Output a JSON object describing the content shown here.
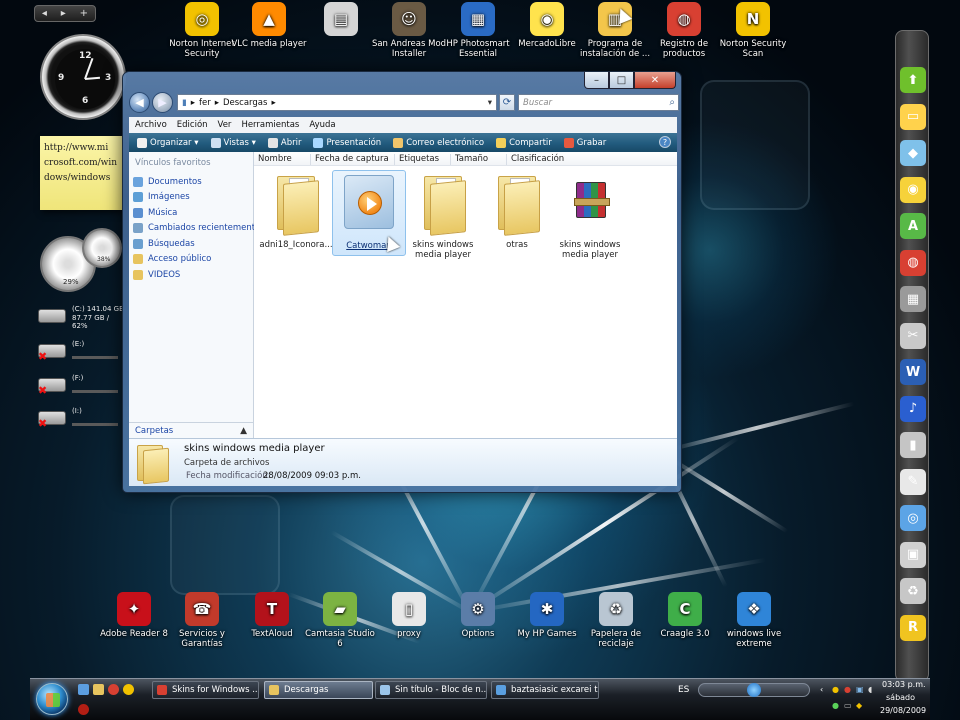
{
  "desktop": {
    "top_icons": [
      {
        "label": "Norton Internet\nSecurity",
        "color": "#f2c200",
        "glyph": "◎"
      },
      {
        "label": "VLC media player",
        "color": "#ff8a00",
        "glyph": "▲"
      },
      {
        "label": "",
        "color": "#d5d5d5",
        "glyph": "▤"
      },
      {
        "label": "San Andreas Mod\nInstaller",
        "color": "#6a5a44",
        "glyph": "☺"
      },
      {
        "label": "HP Photosmart\nEssential",
        "color": "#2a6bc4",
        "glyph": "▦"
      },
      {
        "label": "MercadoLibre",
        "color": "#ffe34d",
        "glyph": "◉"
      },
      {
        "label": "Programa de\ninstalación de ...",
        "color": "#f3c64b",
        "glyph": "▥"
      },
      {
        "label": "Registro de\nproductos",
        "color": "#d84032",
        "glyph": "◍"
      },
      {
        "label": "Norton Security\nScan",
        "color": "#f2c200",
        "glyph": "N"
      }
    ],
    "bottom_icons": [
      {
        "label": "Adobe Reader 8",
        "color": "#c8101a",
        "glyph": "✦"
      },
      {
        "label": "Servicios y\nGarantías",
        "color": "#c23a2b",
        "glyph": "☎"
      },
      {
        "label": "TextAloud",
        "color": "#b3121b",
        "glyph": "T"
      },
      {
        "label": "Camtasia Studio\n6",
        "color": "#7cb342",
        "glyph": "▰"
      },
      {
        "label": "proxy",
        "color": "#e8e8e8",
        "glyph": "▯"
      },
      {
        "label": "Options",
        "color": "#5b7da8",
        "glyph": "⚙"
      },
      {
        "label": "My HP Games",
        "color": "#2467c2",
        "glyph": "✱"
      },
      {
        "label": "Papelera de\nreciclaje",
        "color": "#b9c6d2",
        "glyph": "♻"
      },
      {
        "label": "Craagle 3.0",
        "color": "#3fae49",
        "glyph": "C"
      },
      {
        "label": "windows live\nextreme",
        "color": "#2f85d8",
        "glyph": "❖"
      }
    ]
  },
  "gadgets": {
    "note_lines": [
      "http://www.mi",
      "crosoft.com/win",
      "dows/windows"
    ],
    "meter_cpu": "29%",
    "meter_mem": "38%",
    "drives": [
      {
        "label": "(C:) 141.04 GB",
        "sub": "87.77 GB / 62%",
        "broken": false
      },
      {
        "label": "(E:)",
        "sub": "",
        "broken": true
      },
      {
        "label": "(F:)",
        "sub": "",
        "broken": true
      },
      {
        "label": "(I:)",
        "sub": "",
        "broken": true
      }
    ]
  },
  "window": {
    "caption_min": "–",
    "caption_max": "□",
    "caption_close": "✕",
    "breadcrumb_root": "fer",
    "breadcrumb_leaf": "Descargas",
    "search_placeholder": "Buscar",
    "menu": [
      "Archivo",
      "Edición",
      "Ver",
      "Herramientas",
      "Ayuda"
    ],
    "toolbar": [
      {
        "label": "Organizar ▾",
        "color": "#f0f0f0"
      },
      {
        "label": "Vistas ▾",
        "color": "#cfe0f2"
      },
      {
        "label": "Abrir",
        "color": "#e4e4e4"
      },
      {
        "label": "Presentación",
        "color": "#a8d8ff"
      },
      {
        "label": "Correo electrónico",
        "color": "#f1c56b"
      },
      {
        "label": "Compartir",
        "color": "#f3cf5a"
      },
      {
        "label": "Grabar",
        "color": "#e7593f"
      }
    ],
    "favorites_header": "Vínculos favoritos",
    "favorites": [
      {
        "label": "Documentos",
        "color": "#6aa3dd"
      },
      {
        "label": "Imágenes",
        "color": "#5d9fd6"
      },
      {
        "label": "Música",
        "color": "#5b8fd0"
      },
      {
        "label": "Cambiados recientemente",
        "color": "#7aa2c8"
      },
      {
        "label": "Búsquedas",
        "color": "#6a9fcf"
      },
      {
        "label": "Acceso público",
        "color": "#e7c45f"
      },
      {
        "label": "VIDEOS",
        "color": "#e7c45f"
      }
    ],
    "folders_label": "Carpetas",
    "folders_chevron": "▲",
    "columns": [
      "Nombre",
      "Fecha de captura",
      "Etiquetas",
      "Tamaño",
      "Clasificación"
    ],
    "files": [
      {
        "name": "adni18_Iconora...",
        "kind": "folder",
        "selected": false
      },
      {
        "name": "Catwoman",
        "kind": "wmp",
        "selected": true
      },
      {
        "name": "skins windows\nmedia player",
        "kind": "folder",
        "selected": false
      },
      {
        "name": "otras",
        "kind": "folder",
        "selected": false
      },
      {
        "name": "skins windows\nmedia player",
        "kind": "rar",
        "selected": false
      }
    ],
    "details": {
      "name": "skins windows media player",
      "type": "Carpeta de archivos",
      "date_label": "Fecha modificación:",
      "date": "28/08/2009 09:03 p.m."
    }
  },
  "taskbar": {
    "buttons": [
      {
        "label": "Skins for Windows ...",
        "color": "#d84032",
        "active": false
      },
      {
        "label": "Descargas",
        "color": "#e7c45f",
        "active": true
      },
      {
        "label": "Sin título - Bloc de n...",
        "color": "#9bc5ea",
        "active": false
      },
      {
        "label": "baztasiasic excarei ti...",
        "color": "#5a9fe0",
        "active": false
      }
    ],
    "language": "ES",
    "time": "03:03 p.m.",
    "day": "sábado",
    "date": "29/08/2009"
  },
  "dock_colors": [
    "#6fc02c",
    "#ffd24c",
    "#7fc1ea",
    "#f6d23a",
    "#58b947",
    "#d84032",
    "#9a9a9a",
    "#c9c9c9",
    "#2b5fb4",
    "#2a5fd0",
    "#c5c5c5",
    "#e8e8e8",
    "#5ca4e6",
    "#d0d0d0",
    "#c7c7c7",
    "#f0c420"
  ],
  "dock_glyphs": [
    "⬆",
    "▭",
    "◆",
    "◉",
    "A",
    "◍",
    "▦",
    "✂",
    "W",
    "♪",
    "▮",
    "✎",
    "◎",
    "▣",
    "♻",
    "R"
  ]
}
